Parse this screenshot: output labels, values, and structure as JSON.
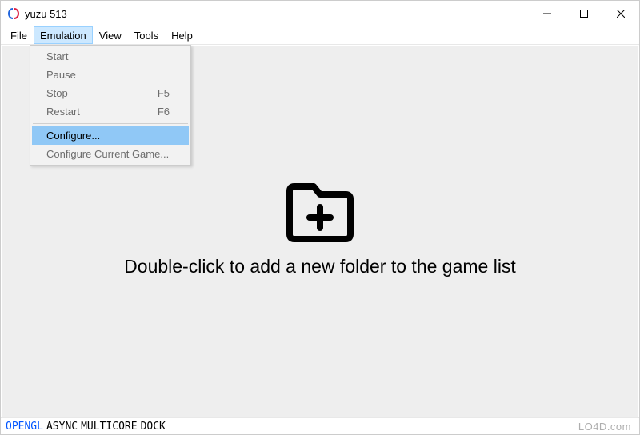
{
  "window": {
    "title": "yuzu 513"
  },
  "menubar": {
    "items": [
      "File",
      "Emulation",
      "View",
      "Tools",
      "Help"
    ],
    "open_index": 1
  },
  "dropdown": {
    "items": [
      {
        "label": "Start",
        "shortcut": "",
        "enabled": false
      },
      {
        "label": "Pause",
        "shortcut": "",
        "enabled": false
      },
      {
        "label": "Stop",
        "shortcut": "F5",
        "enabled": false
      },
      {
        "label": "Restart",
        "shortcut": "F6",
        "enabled": false
      }
    ],
    "items2": [
      {
        "label": "Configure...",
        "shortcut": "",
        "highlight": true
      },
      {
        "label": "Configure Current Game...",
        "shortcut": "",
        "enabled": false
      }
    ]
  },
  "main": {
    "prompt": "Double-click to add a new folder to the game list"
  },
  "statusbar": {
    "opengl": "OPENGL",
    "async": "ASYNC",
    "multicore": "MULTICORE",
    "dock": "DOCK"
  },
  "watermark": "LO4D.com"
}
